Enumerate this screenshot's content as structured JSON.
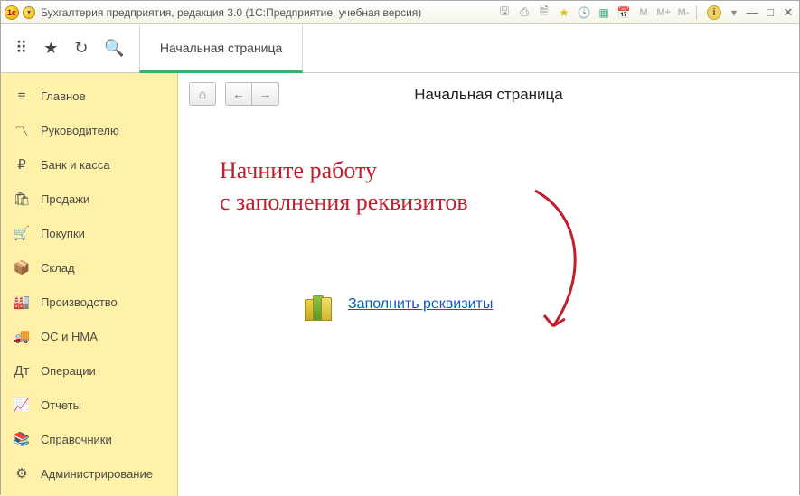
{
  "titlebar": {
    "title": "Бухгалтерия предприятия, редакция 3.0  (1С:Предприятие, учебная версия)",
    "m_buttons": [
      "M",
      "M+",
      "M-"
    ]
  },
  "toolbar": {
    "tab_label": "Начальная страница"
  },
  "sidebar": {
    "items": [
      {
        "label": "Главное"
      },
      {
        "label": "Руководителю"
      },
      {
        "label": "Банк и касса"
      },
      {
        "label": "Продажи"
      },
      {
        "label": "Покупки"
      },
      {
        "label": "Склад"
      },
      {
        "label": "Производство"
      },
      {
        "label": "ОС и НМА"
      },
      {
        "label": "Операции"
      },
      {
        "label": "Отчеты"
      },
      {
        "label": "Справочники"
      },
      {
        "label": "Администрирование"
      }
    ]
  },
  "content": {
    "page_title": "Начальная страница",
    "hint_line1": "Начните работу",
    "hint_line2": "с заполнения реквизитов",
    "action_link": "Заполнить реквизиты"
  }
}
